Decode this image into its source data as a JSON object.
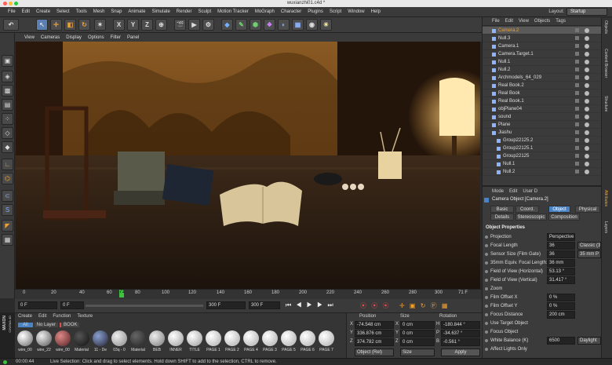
{
  "window": {
    "title": "wuxianzhi01.c4d *"
  },
  "menubar": {
    "items": [
      "File",
      "Edit",
      "Create",
      "Select",
      "Tools",
      "Mesh",
      "Snap",
      "Animate",
      "Simulate",
      "Render",
      "Sculpt",
      "Motion Tracker",
      "MoGraph",
      "Character",
      "Plugins",
      "Script",
      "Window",
      "Help"
    ],
    "layout_label": "Layout:",
    "layout_value": "Startup"
  },
  "toolbar": {
    "axis_x": "X",
    "axis_y": "Y",
    "axis_z": "Z"
  },
  "viewport": {
    "menu": [
      "View",
      "Cameras",
      "Display",
      "Options",
      "Filter",
      "Panel"
    ]
  },
  "timeline": {
    "ticks": [
      "0",
      "20",
      "40",
      "60",
      "80",
      "100",
      "120",
      "140",
      "160",
      "180",
      "200",
      "220",
      "240",
      "260",
      "280",
      "300"
    ],
    "current_frame": "71",
    "end_frame_label": "71 F"
  },
  "transport": {
    "start": "0 F",
    "current": "0 F",
    "max": "300 F",
    "end": "300 F"
  },
  "material_manager": {
    "menu": [
      "Create",
      "Edit",
      "Function",
      "Texture"
    ],
    "filters": [
      "All",
      "No Layer",
      "BOOK"
    ],
    "materials": [
      "wire_00",
      "wire_22",
      "wire_00",
      "Material",
      "11 - De",
      "03q - 0",
      "Material",
      "BEB",
      "INNER",
      "TITLE",
      "PAGE 1",
      "PAGE 2",
      "PAGE 4",
      "PAGE 3",
      "PAGE 5",
      "PAGE 6",
      "PAGE 7"
    ]
  },
  "coordinates": {
    "headers": [
      "Position",
      "Size",
      "Rotation"
    ],
    "rows": [
      {
        "axis": "X",
        "pos": "-74.548 cm",
        "size_axis": "X",
        "size": "0 cm",
        "rot_axis": "H",
        "rot": "-180.844 °"
      },
      {
        "axis": "Y",
        "pos": "336.876 cm",
        "size_axis": "Y",
        "size": "0 cm",
        "rot_axis": "P",
        "rot": "-34.637 °"
      },
      {
        "axis": "Z",
        "pos": "374.782 cm",
        "size_axis": "Z",
        "size": "0 cm",
        "rot_axis": "B",
        "rot": "-0.561 °"
      }
    ],
    "mode": "Object (Rel)",
    "size_mode": "Size",
    "apply": "Apply"
  },
  "status": {
    "time": "00:00:44",
    "message": "Live Selection: Click and drag to select elements. Hold down SHIFT to add to the selection, CTRL to remove."
  },
  "object_manager": {
    "menu": [
      "File",
      "Edit",
      "View",
      "Objects",
      "Tags"
    ],
    "objects": [
      {
        "name": "Camera.2",
        "indent": 0,
        "selected": true
      },
      {
        "name": "Null.3",
        "indent": 0,
        "selected": false
      },
      {
        "name": "Camera.1",
        "indent": 0,
        "selected": false
      },
      {
        "name": "Camera.Target.1",
        "indent": 0,
        "selected": false
      },
      {
        "name": "Null.1",
        "indent": 0,
        "selected": false
      },
      {
        "name": "Null.2",
        "indent": 0,
        "selected": false
      },
      {
        "name": "Archmodels_64_029",
        "indent": 0,
        "selected": false
      },
      {
        "name": "Real Book.2",
        "indent": 0,
        "selected": false
      },
      {
        "name": "Real Book",
        "indent": 0,
        "selected": false
      },
      {
        "name": "Real Book.1",
        "indent": 0,
        "selected": false
      },
      {
        "name": "objPlane04",
        "indent": 0,
        "selected": false
      },
      {
        "name": "sound",
        "indent": 0,
        "selected": false
      },
      {
        "name": "Plane",
        "indent": 0,
        "selected": false
      },
      {
        "name": "Jiashu",
        "indent": 0,
        "selected": false
      },
      {
        "name": "Group22125.2",
        "indent": 1,
        "selected": false
      },
      {
        "name": "Group22125.1",
        "indent": 1,
        "selected": false
      },
      {
        "name": "Group22125",
        "indent": 1,
        "selected": false
      },
      {
        "name": "Null.1",
        "indent": 1,
        "selected": false
      },
      {
        "name": "Null.2",
        "indent": 1,
        "selected": false
      }
    ]
  },
  "attribute_manager": {
    "menu": [
      "Mode",
      "Edit",
      "User D"
    ],
    "object_title": "Camera Object [Camera.2]",
    "tabs_row1": [
      "Basic",
      "Coord.",
      "Object",
      "Physical"
    ],
    "tabs_row2": [
      "Details",
      "Stereoscopic",
      "Composition"
    ],
    "active_tab": "Object",
    "section": "Object Properties",
    "properties": [
      {
        "label": "Projection",
        "value": "Perspective",
        "extra": ""
      },
      {
        "label": "Focal Length",
        "value": "36",
        "extra": "Classic (3"
      },
      {
        "label": "Sensor Size (Film Gate)",
        "value": "36",
        "extra": "35 mm P"
      },
      {
        "label": "35mm Equiv. Focal Length:",
        "value": "36 mm",
        "extra": ""
      },
      {
        "label": "Field of View (Horizontal)",
        "value": "53.13 °",
        "extra": ""
      },
      {
        "label": "Field of View (Vertical)",
        "value": "31.417 °",
        "extra": ""
      },
      {
        "label": "Zoom",
        "value": "",
        "extra": ""
      },
      {
        "label": "Film Offset X",
        "value": "0 %",
        "extra": ""
      },
      {
        "label": "Film Offset Y",
        "value": "0 %",
        "extra": ""
      },
      {
        "label": "Focus Distance",
        "value": "200 cm",
        "extra": ""
      },
      {
        "label": "Use Target Object",
        "value": "",
        "extra": ""
      },
      {
        "label": "Focus Object",
        "value": "",
        "extra": ""
      },
      {
        "label": "White Balance (K)",
        "value": "6500",
        "extra": "Daylight"
      },
      {
        "label": "Affect Lights Only",
        "value": "",
        "extra": ""
      }
    ]
  },
  "side_tabs": [
    "Objects",
    "Content Browser",
    "Structure",
    "Attributes",
    "Layers"
  ],
  "logo": {
    "line1": "MAXON",
    "line2": "CINEMA 4D"
  },
  "colors": {
    "accent_orange": "#e8a33a",
    "selected_row": "#5a5a5a",
    "active_tab": "#4b84c4"
  }
}
